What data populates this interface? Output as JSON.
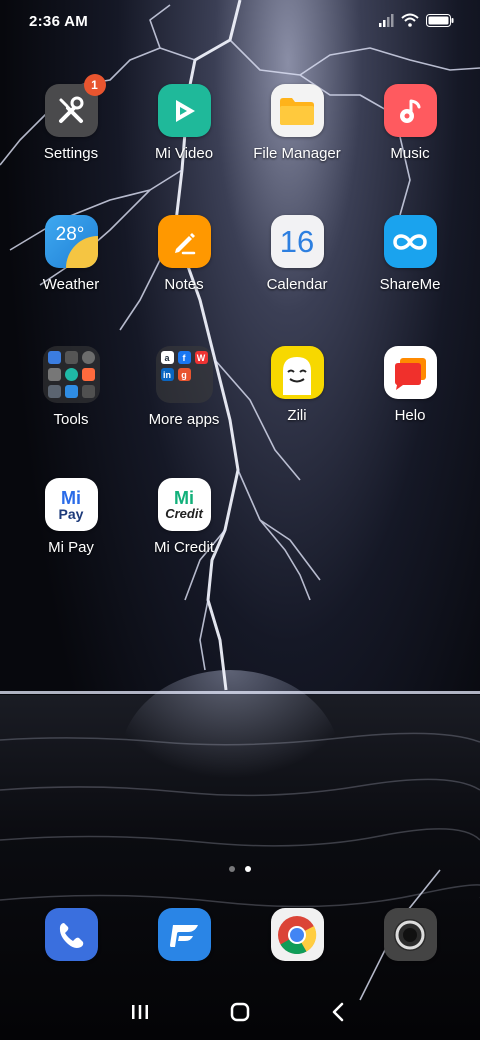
{
  "status_bar": {
    "time": "2:36 AM"
  },
  "apps": {
    "settings": {
      "label": "Settings",
      "badge": "1"
    },
    "mi_video": {
      "label": "Mi Video"
    },
    "file_manager": {
      "label": "File Manager"
    },
    "music": {
      "label": "Music"
    },
    "weather": {
      "label": "Weather",
      "temperature": "28°"
    },
    "notes": {
      "label": "Notes"
    },
    "calendar": {
      "label": "Calendar",
      "date": "16"
    },
    "shareme": {
      "label": "ShareMe"
    },
    "tools": {
      "label": "Tools"
    },
    "more_apps": {
      "label": "More apps",
      "letters": [
        "a",
        "f",
        "W",
        "in",
        "g"
      ]
    },
    "zili": {
      "label": "Zili"
    },
    "helo": {
      "label": "Helo"
    },
    "mi_pay": {
      "label": "Mi Pay",
      "text_top": "Mi",
      "text_bottom": "Pay"
    },
    "mi_credit": {
      "label": "Mi Credit",
      "text_top": "Mi",
      "text_bottom": "Credit"
    }
  },
  "page_indicator": {
    "count": 2,
    "active": 2
  },
  "dock": [
    "phone",
    "messages",
    "chrome",
    "camera"
  ],
  "colors": {
    "badge": "#e8552f",
    "mi_video": "#1fb99a",
    "file_manager": "#ffb31a",
    "music": "#ff5a5f",
    "notes": "#ff9800",
    "calendar_number": "#2d7fe0",
    "shareme": "#1aa3ee",
    "phone": "#3a6fde",
    "messages": "#2a85e6"
  }
}
